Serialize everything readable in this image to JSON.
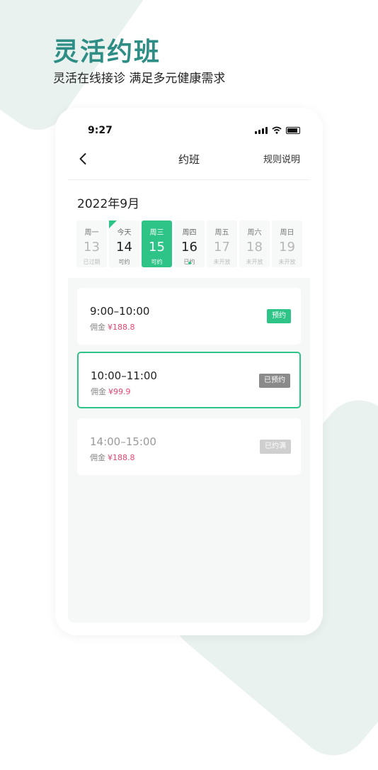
{
  "promo": {
    "title": "灵活约班",
    "subtitle": "灵活在线接诊 满足多元健康需求"
  },
  "status_bar": {
    "time": "9:27",
    "icons": [
      "signal-icon",
      "wifi-icon",
      "battery-icon"
    ]
  },
  "nav": {
    "back_icon": "chevron-left-icon",
    "title": "约班",
    "rules_link": "规则说明"
  },
  "calendar": {
    "month_label": "2022年9月",
    "days": [
      {
        "weekday": "周一",
        "date": "13",
        "status": "已过期"
      },
      {
        "weekday": "今天",
        "date": "14",
        "status": "可约"
      },
      {
        "weekday": "周三",
        "date": "15",
        "status": "可约"
      },
      {
        "weekday": "周四",
        "date": "16",
        "status": "已约"
      },
      {
        "weekday": "周五",
        "date": "17",
        "status": "未开放"
      },
      {
        "weekday": "周六",
        "date": "18",
        "status": "未开放"
      },
      {
        "weekday": "周日",
        "date": "19",
        "status": "未开放"
      }
    ]
  },
  "slots": [
    {
      "time": "9:00–10:00",
      "fee_label": "佣金",
      "fee": "¥188.8",
      "action": "预约"
    },
    {
      "time": "10:00–11:00",
      "fee_label": "佣金",
      "fee": "¥99.9",
      "action": "已预约"
    },
    {
      "time": "14:00–15:00",
      "fee_label": "佣金",
      "fee": "¥188.8",
      "action": "已约满"
    }
  ],
  "colors": {
    "accent": "#2ec487",
    "title_teal": "#2e8e86",
    "price_pink": "#e24570",
    "background_shape": "#eaf2f0"
  }
}
